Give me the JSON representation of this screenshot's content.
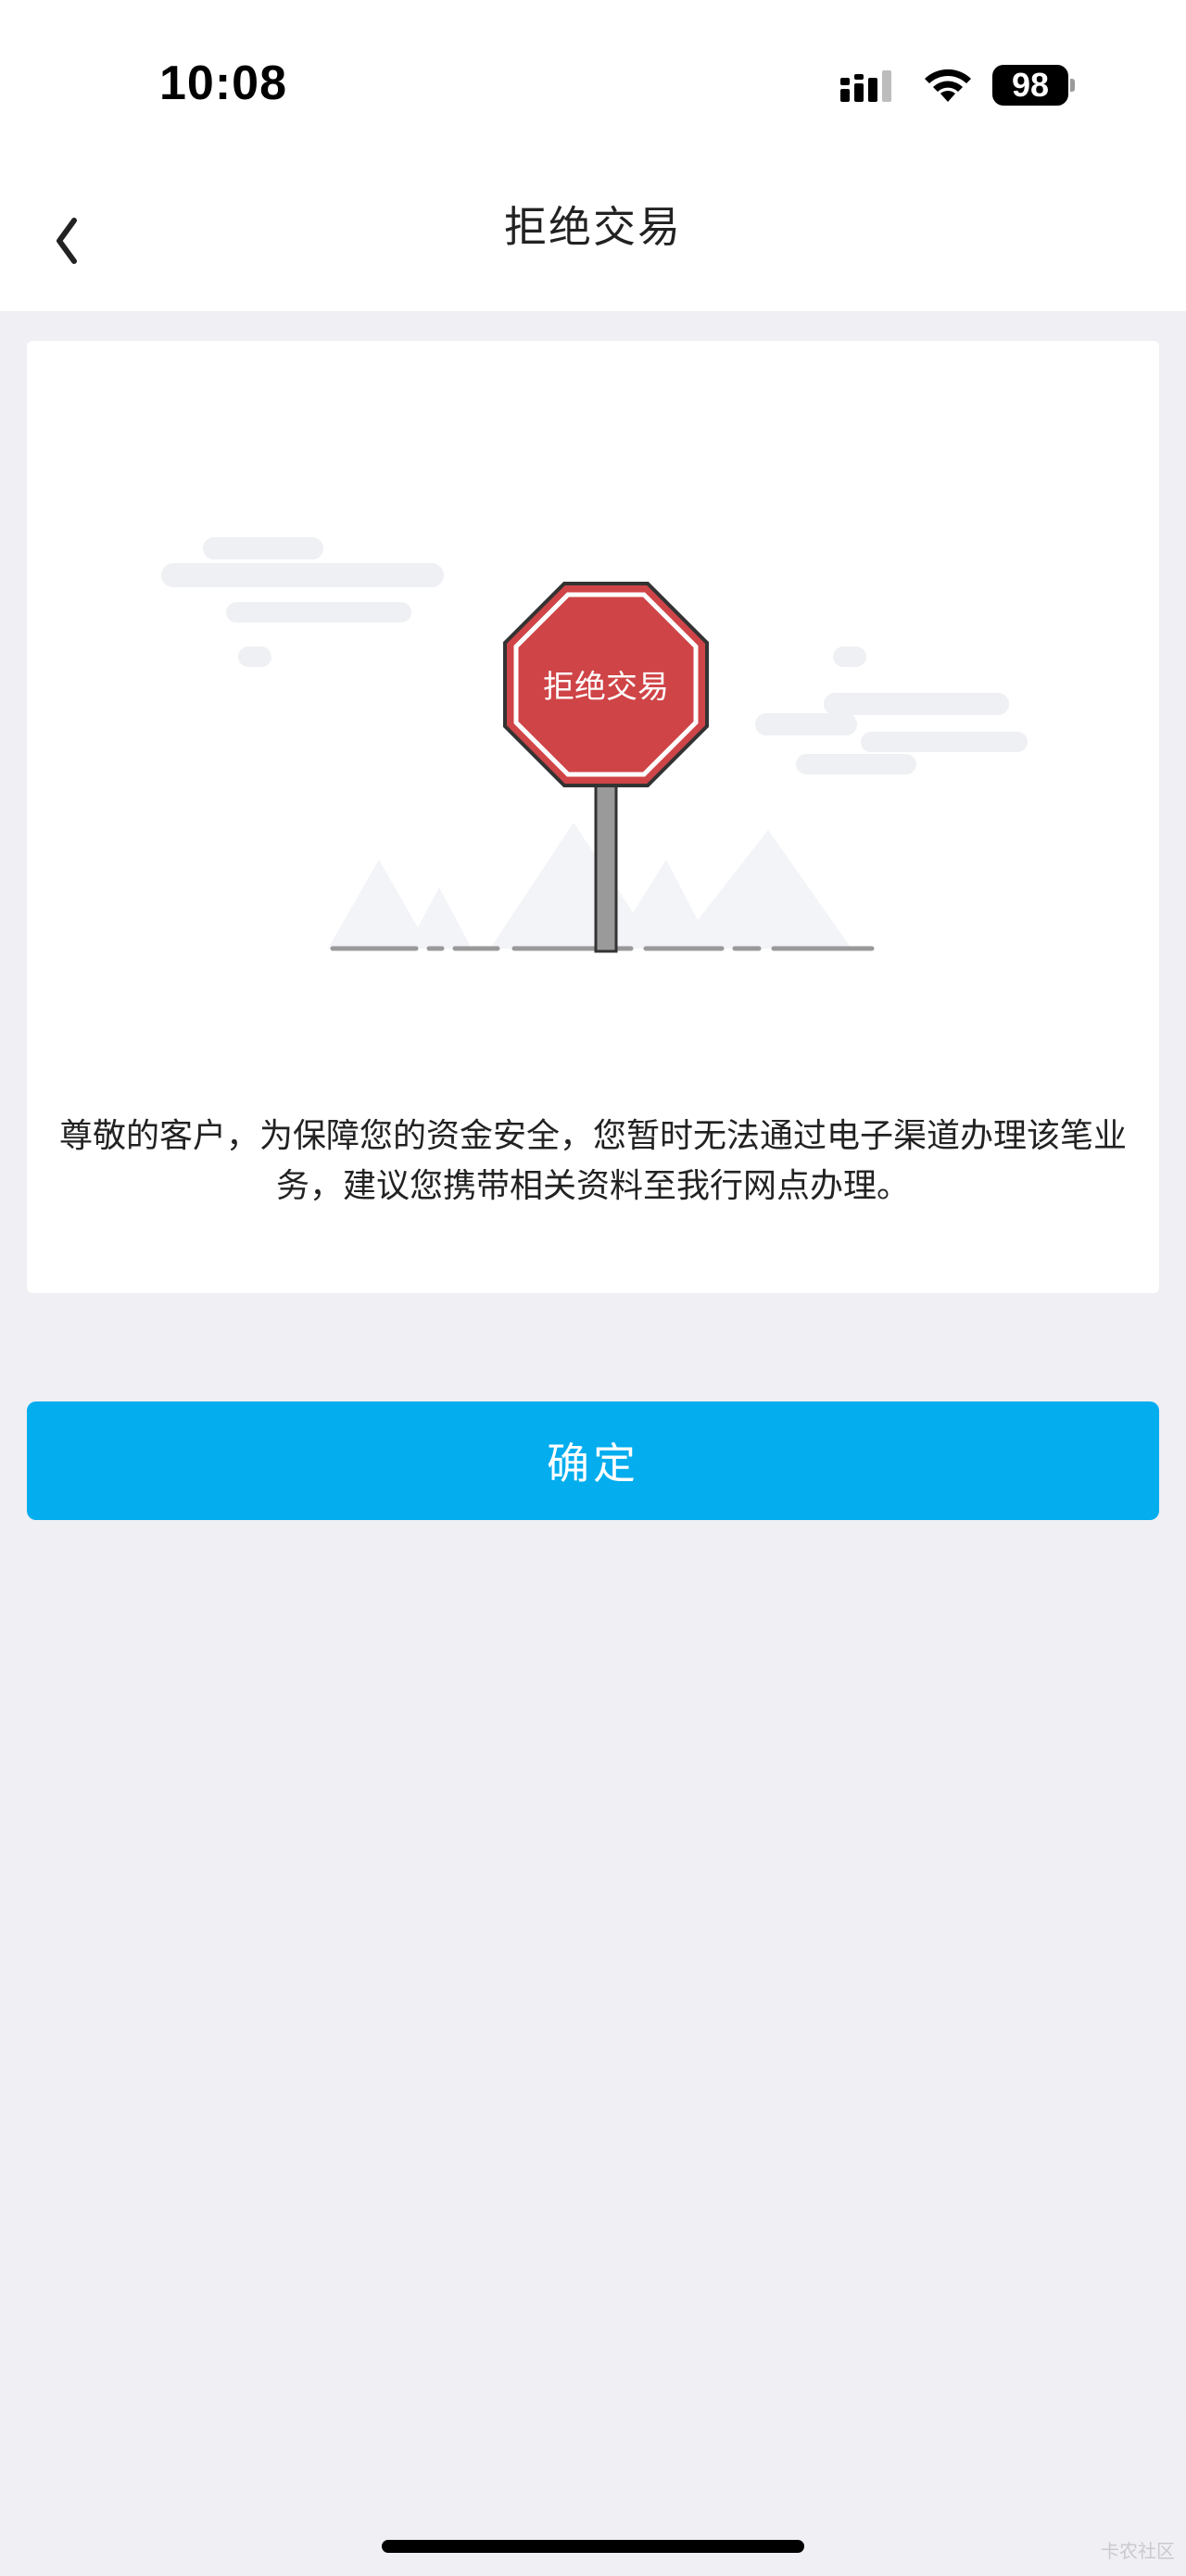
{
  "status_bar": {
    "time": "10:08",
    "battery": "98",
    "icons": [
      "signal-icon",
      "wifi-icon",
      "battery-icon"
    ]
  },
  "nav": {
    "title": "拒绝交易",
    "back_icon": "chevron-left-icon"
  },
  "illustration": {
    "sign_text": "拒绝交易",
    "sign_color": "#CF4447"
  },
  "message": {
    "text": "尊敬的客户，为保障您的资金安全，您暂时无法通过电子渠道办理该笔业务，建议您携带相关资料至我行网点办理。"
  },
  "confirm_button": {
    "label": "确定",
    "color": "#03ADEE"
  },
  "watermark": {
    "text": "卡农社区"
  }
}
